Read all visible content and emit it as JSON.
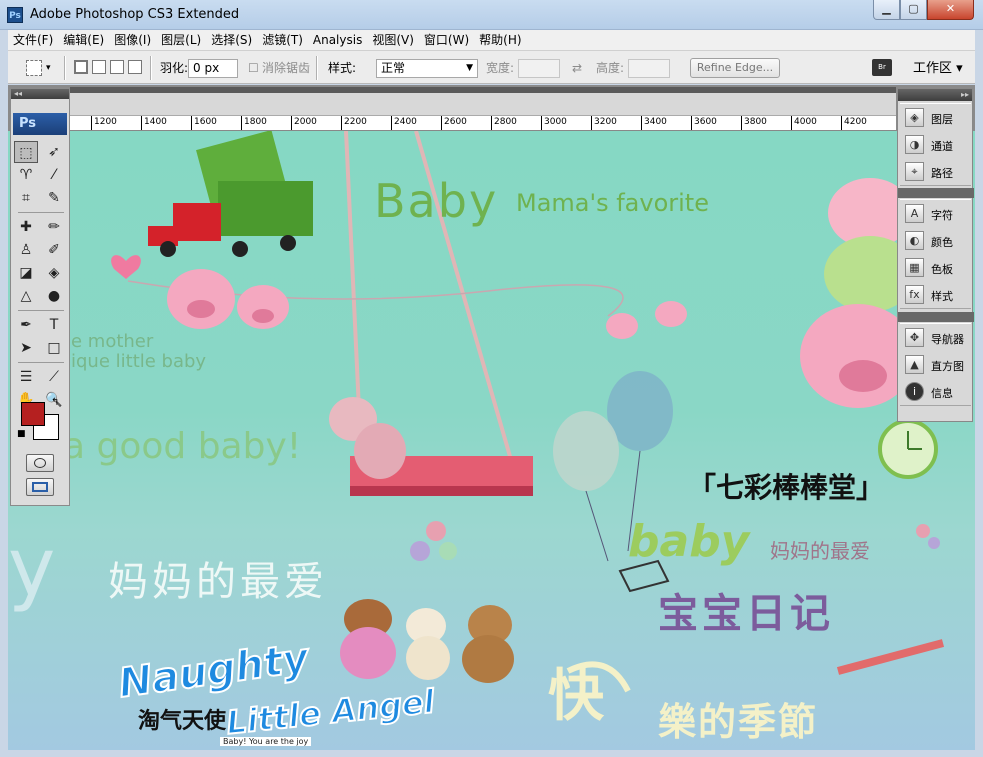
{
  "window": {
    "title": "Adobe Photoshop CS3 Extended",
    "app_icon": "Ps",
    "minimize": "▁",
    "maximize": "▢",
    "close": "✕"
  },
  "menu": [
    "文件(F)",
    "编辑(E)",
    "图像(I)",
    "图层(L)",
    "选择(S)",
    "滤镜(T)",
    "Analysis",
    "视图(V)",
    "窗口(W)",
    "帮助(H)"
  ],
  "options": {
    "feather_label": "羽化:",
    "feather_value": "0 px",
    "antialias_label": "消除锯齿",
    "style_label": "样式:",
    "style_value": "正常",
    "width_label": "宽度:",
    "height_label": "高度:",
    "refine_edge": "Refine Edge..."
  },
  "workspace": {
    "label": "工作区",
    "icon": "workspace-icon"
  },
  "ruler": {
    "labels": [
      "1200",
      "1400",
      "1600",
      "1800",
      "2000",
      "2200",
      "2400",
      "2600",
      "2800",
      "3000",
      "3200",
      "3400",
      "3600",
      "3800",
      "4000",
      "4200"
    ]
  },
  "tools_panel": {
    "logo": "Ps"
  },
  "colors": {
    "foreground": "#b52020",
    "background": "#ffffff"
  },
  "dock": {
    "groups": [
      [
        {
          "label": "图层",
          "icon": "layers-icon"
        },
        {
          "label": "通道",
          "icon": "channels-icon"
        },
        {
          "label": "路径",
          "icon": "paths-icon"
        }
      ],
      [
        {
          "label": "字符",
          "icon": "character-icon"
        },
        {
          "label": "颜色",
          "icon": "color-icon"
        },
        {
          "label": "色板",
          "icon": "swatches-icon"
        },
        {
          "label": "样式",
          "icon": "styles-icon"
        }
      ],
      [
        {
          "label": "导航器",
          "icon": "navigator-icon"
        },
        {
          "label": "直方图",
          "icon": "histogram-icon"
        },
        {
          "label": "信息",
          "icon": "info-icon"
        }
      ]
    ]
  },
  "canvas_text": {
    "baby": "Baby",
    "mamas_favorite": "Mama's favorite",
    "mother": "e mother",
    "unique": "ique little baby",
    "good_baby": "a good baby!",
    "joy": "y",
    "mama_fav_cn": "妈妈的最爱",
    "qicai": "「七彩棒棒堂」",
    "baby2": "baby",
    "mama_fav_cn2": "妈妈的最爱",
    "baobao": "宝宝日记",
    "kuaile": "快",
    "jijie": "樂的季節",
    "naughty": "Naughty",
    "little_angel": "Little Angel",
    "taoqi": "淘气天使",
    "tagline": "Baby! You are the joy"
  }
}
